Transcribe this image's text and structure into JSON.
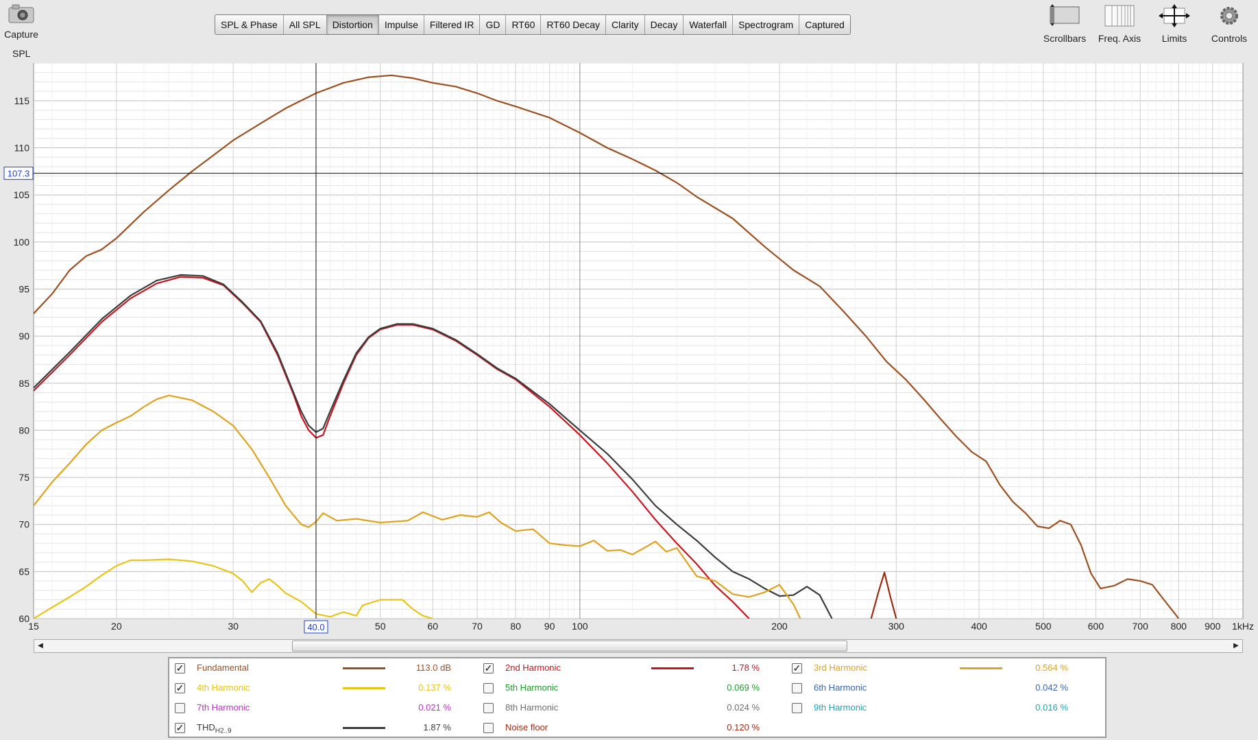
{
  "capture": {
    "label": "Capture",
    "icon": "camera-icon"
  },
  "y_unit_label": "SPL",
  "tabs": [
    {
      "label": "SPL & Phase",
      "active": false
    },
    {
      "label": "All SPL",
      "active": false
    },
    {
      "label": "Distortion",
      "active": true
    },
    {
      "label": "Impulse",
      "active": false
    },
    {
      "label": "Filtered IR",
      "active": false
    },
    {
      "label": "GD",
      "active": false
    },
    {
      "label": "RT60",
      "active": false
    },
    {
      "label": "RT60 Decay",
      "active": false
    },
    {
      "label": "Clarity",
      "active": false
    },
    {
      "label": "Decay",
      "active": false
    },
    {
      "label": "Waterfall",
      "active": false
    },
    {
      "label": "Spectrogram",
      "active": false
    },
    {
      "label": "Captured",
      "active": false
    }
  ],
  "tools": [
    {
      "label": "Scrollbars",
      "icon": "scrollbars-icon"
    },
    {
      "label": "Freq. Axis",
      "icon": "freq-axis-icon"
    },
    {
      "label": "Limits",
      "icon": "limits-icon"
    },
    {
      "label": "Controls",
      "icon": "gear-icon"
    }
  ],
  "cursor": {
    "x_label": "40.0",
    "y_label": "107.3"
  },
  "legend": [
    {
      "name": "Fundamental",
      "checked": true,
      "value": "113.0 dB",
      "color": "#9b4f1f",
      "show_line": true
    },
    {
      "name": "2nd Harmonic",
      "checked": true,
      "value": "1.78 %",
      "color": "#c8141c",
      "show_line": true
    },
    {
      "name": "3rd Harmonic",
      "checked": true,
      "value": "0.564 %",
      "color": "#e0a21c",
      "show_line": true
    },
    {
      "name": "4th Harmonic",
      "checked": true,
      "value": "0.137 %",
      "color": "#e8c414",
      "show_line": true
    },
    {
      "name": "5th Harmonic",
      "checked": false,
      "value": "0.069 %",
      "color": "#1e9a2a",
      "show_line": false
    },
    {
      "name": "6th Harmonic",
      "checked": false,
      "value": "0.042 %",
      "color": "#3a64b0",
      "show_line": false
    },
    {
      "name": "7th Harmonic",
      "checked": false,
      "value": "0.021 %",
      "color": "#c42ad0",
      "show_line": false
    },
    {
      "name": "8th Harmonic",
      "checked": false,
      "value": "0.024 %",
      "color": "#6e6e6e",
      "show_line": false
    },
    {
      "name": "9th Harmonic",
      "checked": false,
      "value": "0.016 %",
      "color": "#1aa6b4",
      "show_line": false
    },
    {
      "name": "THD",
      "name_sub": "H2..9",
      "checked": true,
      "value": "1.87 %",
      "color": "#3a3a3a",
      "show_line": true
    },
    {
      "name": "Noise floor",
      "checked": false,
      "value": "0.120 %",
      "color": "#9b2a10",
      "show_line": false
    }
  ],
  "chart_data": {
    "type": "line",
    "x_scale": "log",
    "xlim": [
      15,
      1000
    ],
    "ylim": [
      60,
      119
    ],
    "ylabel": "SPL",
    "grid": true,
    "x_ticks": [
      {
        "v": 15,
        "label": "15"
      },
      {
        "v": 20,
        "label": "20"
      },
      {
        "v": 30,
        "label": "30"
      },
      {
        "v": 50,
        "label": "50"
      },
      {
        "v": 60,
        "label": "60"
      },
      {
        "v": 70,
        "label": "70"
      },
      {
        "v": 80,
        "label": "80"
      },
      {
        "v": 90,
        "label": "90"
      },
      {
        "v": 100,
        "label": "100"
      },
      {
        "v": 200,
        "label": "200"
      },
      {
        "v": 300,
        "label": "300"
      },
      {
        "v": 400,
        "label": "400"
      },
      {
        "v": 500,
        "label": "500"
      },
      {
        "v": 600,
        "label": "600"
      },
      {
        "v": 700,
        "label": "700"
      },
      {
        "v": 800,
        "label": "800"
      },
      {
        "v": 900,
        "label": "900"
      },
      {
        "v": 1000,
        "label": "1kHz"
      }
    ],
    "y_ticks": [
      60,
      65,
      70,
      75,
      80,
      85,
      90,
      95,
      100,
      105,
      110,
      115
    ],
    "cursor": {
      "x": 40.0,
      "y": 107.3
    },
    "series": [
      {
        "name": "Fundamental",
        "color": "#9b4f1f",
        "points": [
          [
            15,
            92.4
          ],
          [
            16,
            94.5
          ],
          [
            17,
            97
          ],
          [
            18,
            98.5
          ],
          [
            19,
            99.2
          ],
          [
            20,
            100.4
          ],
          [
            22,
            103.2
          ],
          [
            24,
            105.5
          ],
          [
            26,
            107.5
          ],
          [
            28,
            109.2
          ],
          [
            30,
            110.8
          ],
          [
            33,
            112.6
          ],
          [
            36,
            114.2
          ],
          [
            40,
            115.8
          ],
          [
            44,
            116.9
          ],
          [
            48,
            117.5
          ],
          [
            52,
            117.7
          ],
          [
            56,
            117.4
          ],
          [
            60,
            116.9
          ],
          [
            65,
            116.5
          ],
          [
            70,
            115.8
          ],
          [
            75,
            115
          ],
          [
            80,
            114.4
          ],
          [
            90,
            113.2
          ],
          [
            100,
            111.6
          ],
          [
            110,
            110
          ],
          [
            120,
            108.8
          ],
          [
            130,
            107.6
          ],
          [
            140,
            106.3
          ],
          [
            150,
            104.8
          ],
          [
            170,
            102.5
          ],
          [
            190,
            99.5
          ],
          [
            210,
            97
          ],
          [
            230,
            95.3
          ],
          [
            250,
            92.6
          ],
          [
            270,
            90
          ],
          [
            290,
            87.3
          ],
          [
            310,
            85.4
          ],
          [
            330,
            83.3
          ],
          [
            350,
            81.2
          ],
          [
            370,
            79.3
          ],
          [
            390,
            77.7
          ],
          [
            410,
            76.7
          ],
          [
            430,
            74.2
          ],
          [
            450,
            72.4
          ],
          [
            470,
            71.2
          ],
          [
            490,
            69.8
          ],
          [
            510,
            69.6
          ],
          [
            530,
            70.4
          ],
          [
            550,
            70
          ],
          [
            570,
            67.8
          ],
          [
            590,
            64.8
          ],
          [
            610,
            63.2
          ],
          [
            640,
            63.5
          ],
          [
            670,
            64.2
          ],
          [
            700,
            64
          ],
          [
            730,
            63.6
          ],
          [
            760,
            62
          ],
          [
            790,
            60.5
          ],
          [
            800,
            60
          ]
        ]
      },
      {
        "name": "2nd Harmonic",
        "color": "#c8141c",
        "points": [
          [
            15,
            84.2
          ],
          [
            17,
            88
          ],
          [
            19,
            91.5
          ],
          [
            21,
            94
          ],
          [
            23,
            95.6
          ],
          [
            25,
            96.3
          ],
          [
            27,
            96.2
          ],
          [
            29,
            95.4
          ],
          [
            31,
            93.5
          ],
          [
            33,
            91.5
          ],
          [
            35,
            88
          ],
          [
            37,
            83.8
          ],
          [
            38,
            81.5
          ],
          [
            39,
            80
          ],
          [
            40,
            79.2
          ],
          [
            41,
            79.5
          ],
          [
            42,
            81.5
          ],
          [
            44,
            85
          ],
          [
            46,
            88
          ],
          [
            48,
            89.8
          ],
          [
            50,
            90.7
          ],
          [
            53,
            91.2
          ],
          [
            56,
            91.2
          ],
          [
            60,
            90.7
          ],
          [
            65,
            89.5
          ],
          [
            70,
            88
          ],
          [
            75,
            86.5
          ],
          [
            80,
            85.4
          ],
          [
            90,
            82.5
          ],
          [
            100,
            79.5
          ],
          [
            110,
            76.5
          ],
          [
            120,
            73.5
          ],
          [
            130,
            70.5
          ],
          [
            140,
            68
          ],
          [
            150,
            65.8
          ],
          [
            160,
            63.5
          ],
          [
            170,
            61.8
          ],
          [
            180,
            60
          ]
        ]
      },
      {
        "name": "THD",
        "color": "#3a3a3a",
        "points": [
          [
            15,
            84.5
          ],
          [
            17,
            88.3
          ],
          [
            19,
            91.8
          ],
          [
            21,
            94.3
          ],
          [
            23,
            95.9
          ],
          [
            25,
            96.5
          ],
          [
            27,
            96.4
          ],
          [
            29,
            95.5
          ],
          [
            31,
            93.6
          ],
          [
            33,
            91.6
          ],
          [
            35,
            88.2
          ],
          [
            37,
            84
          ],
          [
            38,
            82
          ],
          [
            39,
            80.5
          ],
          [
            40,
            79.8
          ],
          [
            41,
            80.2
          ],
          [
            42,
            82
          ],
          [
            44,
            85.3
          ],
          [
            46,
            88.2
          ],
          [
            48,
            89.9
          ],
          [
            50,
            90.8
          ],
          [
            53,
            91.3
          ],
          [
            56,
            91.3
          ],
          [
            60,
            90.8
          ],
          [
            65,
            89.6
          ],
          [
            70,
            88.1
          ],
          [
            75,
            86.6
          ],
          [
            80,
            85.5
          ],
          [
            90,
            82.8
          ],
          [
            100,
            80
          ],
          [
            110,
            77.5
          ],
          [
            120,
            74.8
          ],
          [
            130,
            72
          ],
          [
            140,
            70
          ],
          [
            150,
            68.3
          ],
          [
            160,
            66.5
          ],
          [
            170,
            65
          ],
          [
            180,
            64.2
          ],
          [
            190,
            63.2
          ],
          [
            200,
            62.4
          ],
          [
            210,
            62.5
          ],
          [
            220,
            63.4
          ],
          [
            230,
            62.5
          ],
          [
            240,
            60
          ]
        ]
      },
      {
        "name": "3rd Harmonic",
        "color": "#e0a21c",
        "points": [
          [
            15,
            72
          ],
          [
            16,
            74.5
          ],
          [
            17,
            76.5
          ],
          [
            18,
            78.5
          ],
          [
            19,
            80
          ],
          [
            20,
            80.8
          ],
          [
            21,
            81.5
          ],
          [
            22,
            82.5
          ],
          [
            23,
            83.3
          ],
          [
            24,
            83.7
          ],
          [
            26,
            83.2
          ],
          [
            28,
            82
          ],
          [
            30,
            80.5
          ],
          [
            32,
            78
          ],
          [
            34,
            75
          ],
          [
            36,
            72
          ],
          [
            38,
            70
          ],
          [
            39,
            69.7
          ],
          [
            40,
            70.3
          ],
          [
            41,
            71.2
          ],
          [
            43,
            70.4
          ],
          [
            46,
            70.6
          ],
          [
            50,
            70.2
          ],
          [
            55,
            70.4
          ],
          [
            58,
            71.3
          ],
          [
            62,
            70.5
          ],
          [
            66,
            71
          ],
          [
            70,
            70.8
          ],
          [
            73,
            71.3
          ],
          [
            76,
            70.2
          ],
          [
            80,
            69.3
          ],
          [
            85,
            69.5
          ],
          [
            90,
            68
          ],
          [
            95,
            67.8
          ],
          [
            100,
            67.7
          ],
          [
            105,
            68.3
          ],
          [
            110,
            67.2
          ],
          [
            115,
            67.3
          ],
          [
            120,
            66.8
          ],
          [
            125,
            67.5
          ],
          [
            130,
            68.2
          ],
          [
            135,
            67.1
          ],
          [
            140,
            67.5
          ],
          [
            150,
            64.5
          ],
          [
            160,
            64
          ],
          [
            170,
            62.6
          ],
          [
            180,
            62.3
          ],
          [
            190,
            62.8
          ],
          [
            200,
            63.6
          ],
          [
            210,
            61.5
          ],
          [
            215,
            60
          ]
        ]
      },
      {
        "name": "4th Harmonic",
        "color": "#e8c414",
        "points": [
          [
            15,
            60
          ],
          [
            16,
            61.2
          ],
          [
            17,
            62.3
          ],
          [
            18,
            63.4
          ],
          [
            19,
            64.6
          ],
          [
            20,
            65.6
          ],
          [
            21,
            66.2
          ],
          [
            22,
            66.2
          ],
          [
            24,
            66.3
          ],
          [
            26,
            66.1
          ],
          [
            28,
            65.6
          ],
          [
            30,
            64.8
          ],
          [
            31,
            64
          ],
          [
            32,
            62.8
          ],
          [
            33,
            63.8
          ],
          [
            34,
            64.2
          ],
          [
            35,
            63.5
          ],
          [
            36,
            62.7
          ],
          [
            38,
            61.8
          ],
          [
            40,
            60.5
          ],
          [
            42,
            60.2
          ],
          [
            44,
            60.7
          ],
          [
            46,
            60.3
          ],
          [
            47,
            61.4
          ],
          [
            50,
            62
          ],
          [
            54,
            62
          ],
          [
            56,
            61
          ],
          [
            58,
            60.3
          ],
          [
            60,
            60
          ]
        ]
      },
      {
        "name": "Noise spike",
        "color": "#9b2a10",
        "points": [
          [
            275,
            60
          ],
          [
            282,
            62.8
          ],
          [
            288,
            64.9
          ],
          [
            294,
            62.3
          ],
          [
            300,
            60
          ]
        ]
      }
    ]
  }
}
